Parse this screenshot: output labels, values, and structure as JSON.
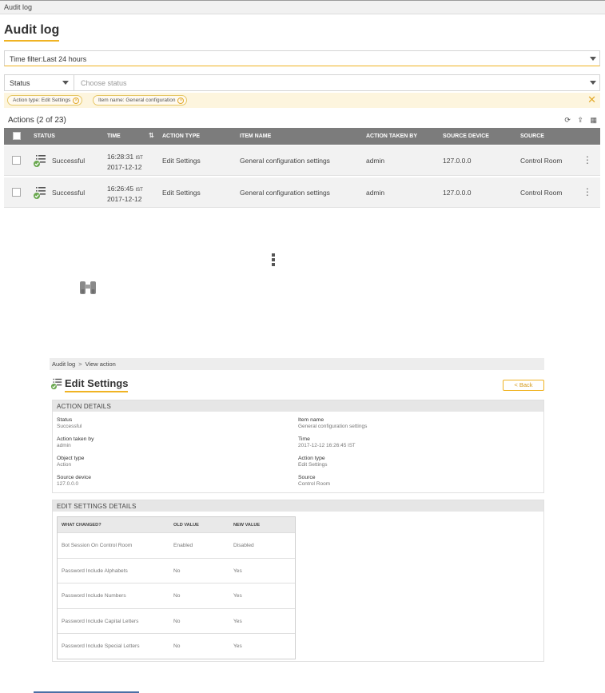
{
  "app_bar": {
    "title": "Audit log"
  },
  "page": {
    "title": "Audit log"
  },
  "time_filter": {
    "label": "Time filter:Last 24 hours"
  },
  "status_filter": {
    "selected": "Status",
    "placeholder": "Choose status"
  },
  "chips": [
    {
      "text": "Action type: Edit Settings"
    },
    {
      "text": "Item name: General configuration"
    }
  ],
  "table": {
    "count_label": "Actions (2 of 23)",
    "headers": {
      "status": "STATUS",
      "time": "TIME",
      "action_type": "ACTION TYPE",
      "item_name": "ITEM NAME",
      "action_taken_by": "ACTION TAKEN BY",
      "source_device": "SOURCE DEVICE",
      "source": "SOURCE"
    },
    "rows": [
      {
        "status": "Successful",
        "time": "16:28:31",
        "tz": "IST",
        "date": "2017-12-12",
        "action_type": "Edit Settings",
        "item_name": "General configuration settings",
        "action_taken_by": "admin",
        "source_device": "127.0.0.0",
        "source": "Control Room"
      },
      {
        "status": "Successful",
        "time": "16:26:45",
        "tz": "IST",
        "date": "2017-12-12",
        "action_type": "Edit Settings",
        "item_name": "General configuration settings",
        "action_taken_by": "admin",
        "source_device": "127.0.0.0",
        "source": "Control Room"
      }
    ]
  },
  "view_action": {
    "breadcrumb": {
      "root": "Audit log",
      "sep": ">",
      "current": "View action"
    },
    "title": "Edit Settings",
    "back_label": "< Back",
    "action_details": {
      "heading": "ACTION DETAILS",
      "status_label": "Status",
      "status_value": "Successful",
      "taken_by_label": "Action taken by",
      "taken_by_value": "admin",
      "object_type_label": "Object type",
      "object_type_value": "Action",
      "source_device_label": "Source device",
      "source_device_value": "127.0.0.0",
      "item_name_label": "Item name",
      "item_name_value": "General configuration settings",
      "time_label": "Time",
      "time_value": "2017-12-12 16:26:45",
      "time_tz": "IST",
      "action_type_label": "Action type",
      "action_type_value": "Edit Settings",
      "source_label": "Source",
      "source_value": "Control Room"
    },
    "edit_details": {
      "heading": "EDIT SETTINGS DETAILS",
      "headers": {
        "what": "WHAT CHANGED?",
        "old": "OLD VALUE",
        "new": "NEW VALUE"
      },
      "rows": [
        {
          "what": "Bot Session On Control Room",
          "old": "Enabled",
          "new": "Disabled"
        },
        {
          "what": "Password Include Alphabets",
          "old": "No",
          "new": "Yes"
        },
        {
          "what": "Password Include Numbers",
          "old": "No",
          "new": "Yes"
        },
        {
          "what": "Password Include Capital Letters",
          "old": "No",
          "new": "Yes"
        },
        {
          "what": "Password Include Special Letters",
          "old": "No",
          "new": "Yes"
        }
      ]
    }
  },
  "icons": {
    "refresh": "refresh-icon",
    "export": "export-icon",
    "columns": "columns-icon",
    "status_success": "audit-success-icon",
    "kebab": "kebab-menu-icon",
    "binoculars": "binoculars-icon"
  },
  "colors": {
    "accent": "#f0b323",
    "header_gray": "#7c7c7c",
    "success_green": "#6aa84f"
  }
}
